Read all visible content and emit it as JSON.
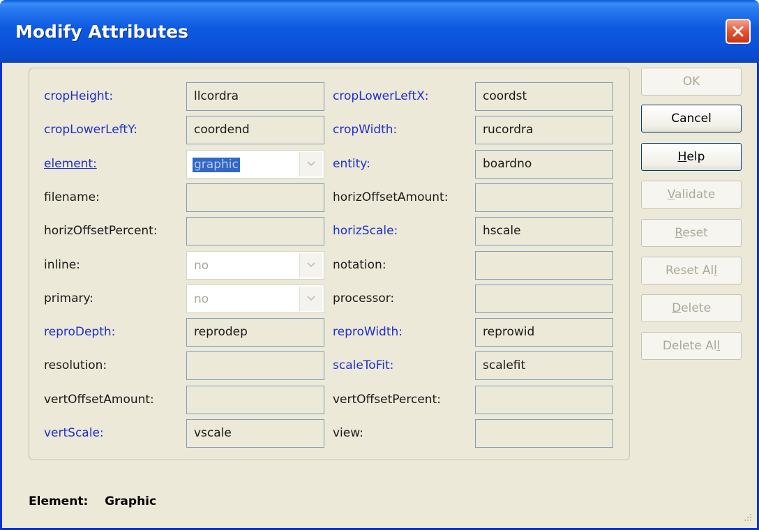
{
  "window": {
    "title": "Modify Attributes"
  },
  "attributes": [
    {
      "key": "cropHeight",
      "label": "cropHeight:",
      "value": "llcordra",
      "style": "req",
      "control": "text"
    },
    {
      "key": "cropLowerLeftX",
      "label": "cropLowerLeftX:",
      "value": "coordst",
      "style": "req",
      "control": "text"
    },
    {
      "key": "cropLowerLeftY",
      "label": "cropLowerLeftY:",
      "value": "coordend",
      "style": "req",
      "control": "text"
    },
    {
      "key": "cropWidth",
      "label": "cropWidth:",
      "value": "rucordra",
      "style": "req",
      "control": "text"
    },
    {
      "key": "element",
      "label": "element:",
      "value": "graphic",
      "style": "link",
      "control": "combo",
      "selected": true
    },
    {
      "key": "entity",
      "label": "entity:",
      "value": "boardno",
      "style": "req",
      "control": "text"
    },
    {
      "key": "filename",
      "label": "filename:",
      "value": "",
      "style": "normal",
      "control": "text"
    },
    {
      "key": "horizOffsetAmount",
      "label": "horizOffsetAmount:",
      "value": "",
      "style": "normal",
      "control": "text"
    },
    {
      "key": "horizOffsetPercent",
      "label": "horizOffsetPercent:",
      "value": "",
      "style": "normal",
      "control": "text"
    },
    {
      "key": "horizScale",
      "label": "horizScale:",
      "value": "hscale",
      "style": "req",
      "control": "text"
    },
    {
      "key": "inline",
      "label": "inline:",
      "value": "no",
      "style": "normal",
      "control": "combo"
    },
    {
      "key": "notation",
      "label": "notation:",
      "value": "",
      "style": "normal",
      "control": "text"
    },
    {
      "key": "primary",
      "label": "primary:",
      "value": "no",
      "style": "normal",
      "control": "combo"
    },
    {
      "key": "processor",
      "label": "processor:",
      "value": "",
      "style": "normal",
      "control": "text"
    },
    {
      "key": "reproDepth",
      "label": "reproDepth:",
      "value": "reprodep",
      "style": "req",
      "control": "text"
    },
    {
      "key": "reproWidth",
      "label": "reproWidth:",
      "value": "reprowid",
      "style": "req",
      "control": "text"
    },
    {
      "key": "resolution",
      "label": "resolution:",
      "value": "",
      "style": "normal",
      "control": "text"
    },
    {
      "key": "scaleToFit",
      "label": "scaleToFit:",
      "value": "scalefit",
      "style": "req",
      "control": "text"
    },
    {
      "key": "vertOffsetAmount",
      "label": "vertOffsetAmount:",
      "value": "",
      "style": "normal",
      "control": "text"
    },
    {
      "key": "vertOffsetPercent",
      "label": "vertOffsetPercent:",
      "value": "",
      "style": "normal",
      "control": "text"
    },
    {
      "key": "vertScale",
      "label": "vertScale:",
      "value": "vscale",
      "style": "req",
      "control": "text"
    },
    {
      "key": "view",
      "label": "view:",
      "value": "",
      "style": "normal",
      "control": "text"
    }
  ],
  "buttons": {
    "ok": {
      "label": "OK",
      "enabled": false
    },
    "cancel": {
      "label": "Cancel",
      "enabled": true
    },
    "help": {
      "label": "Help",
      "enabled": true,
      "mnemonic": "H"
    },
    "validate": {
      "label": "Validate",
      "enabled": false,
      "mnemonic": "V"
    },
    "reset": {
      "label": "Reset",
      "enabled": false,
      "mnemonic": "R"
    },
    "reset_all": {
      "label": "Reset All",
      "enabled": false,
      "mnemonic": "l"
    },
    "delete": {
      "label": "Delete",
      "enabled": false,
      "mnemonic": "D"
    },
    "delete_all": {
      "label": "Delete All",
      "enabled": false,
      "mnemonic": "l"
    }
  },
  "status": {
    "label": "Element:",
    "value": "Graphic"
  },
  "icons": {
    "close": "close-icon",
    "dropdown": "chevron-down-icon",
    "grip": "resize-grip-icon"
  },
  "colors": {
    "required_label": "#1e2fd0",
    "titlebar": "#0a52d9",
    "close_button": "#e2502c",
    "selection": "#3168c6"
  }
}
